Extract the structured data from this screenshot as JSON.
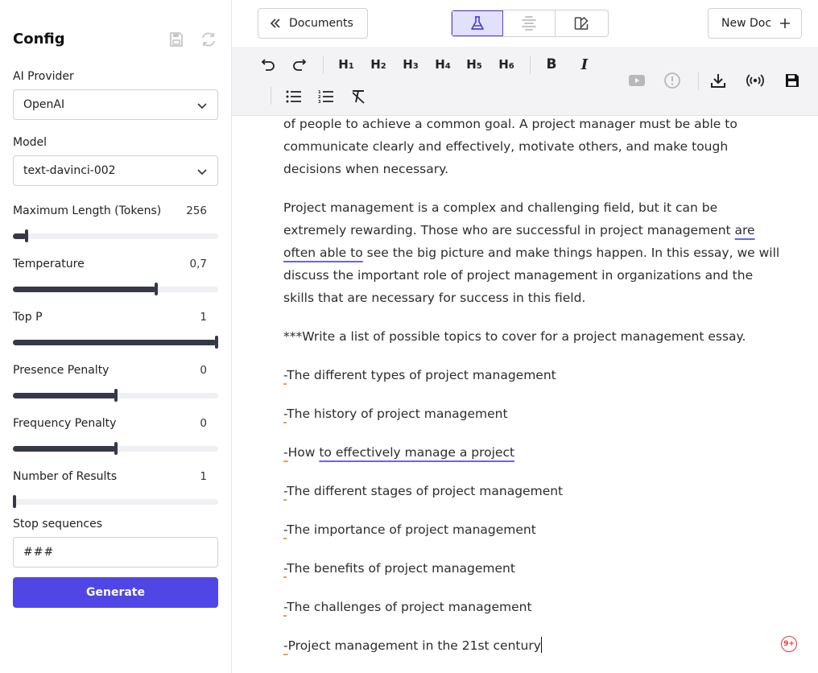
{
  "sidebar": {
    "title": "Config",
    "ai_provider": {
      "label": "AI Provider",
      "value": "OpenAI"
    },
    "model": {
      "label": "Model",
      "value": "text-davinci-002"
    },
    "sliders": [
      {
        "label": "Maximum Length (Tokens)",
        "value": "256",
        "fraction": 0.06
      },
      {
        "label": "Temperature",
        "value": "0,7",
        "fraction": 0.7
      },
      {
        "label": "Top P",
        "value": "1",
        "fraction": 1.0
      },
      {
        "label": "Presence Penalty",
        "value": "0",
        "fraction": 0.5
      },
      {
        "label": "Frequency Penalty",
        "value": "0",
        "fraction": 0.5
      },
      {
        "label": "Number of Results",
        "value": "1",
        "fraction": 0.0
      }
    ],
    "stop_sequences": {
      "label": "Stop sequences",
      "value": "###"
    },
    "generate_label": "Generate"
  },
  "topbar": {
    "documents_label": "Documents",
    "new_doc_label": "New Doc"
  },
  "toolbar": {
    "headings": [
      "H1",
      "H2",
      "H3",
      "H4",
      "H5",
      "H6"
    ],
    "bold": "B",
    "italic": "I"
  },
  "editor": {
    "para1": "of people to achieve a common goal. A project manager must be able to communicate clearly and effectively, motivate others, and make tough decisions when necessary.",
    "para2": {
      "before": "Project management is a complex and challenging field, but it can be extremely rewarding. Those who are successful in project management ",
      "highlight": "are often able to",
      "after": " see the big picture and make things happen. In this essay, we will discuss the important role of project management in organizations and the skills that are necessary for success in this field."
    },
    "prompt": "***Write a list of possible topics to cover for a project management essay.",
    "items": [
      {
        "dash": "-",
        "text": "The different types of project management"
      },
      {
        "dash": "-",
        "text": "The history of project management"
      },
      {
        "dash": "-",
        "text": "How ",
        "highlight": "to effectively manage a project"
      },
      {
        "dash": "-",
        "text": "The different stages of project management"
      },
      {
        "dash": "-",
        "text": "The importance of project management"
      },
      {
        "dash": "-",
        "text": "The benefits of project management"
      },
      {
        "dash": "-",
        "text": "The challenges of project management"
      },
      {
        "dash": "-",
        "text": "Project management in the 21st century"
      }
    ],
    "badge": "9+"
  },
  "colors": {
    "accent": "#5046e5",
    "slider_fill": "#343a48",
    "underline_blue": "#6b63e8",
    "underline_orange": "#f0a040",
    "badge_red": "#e03a3a"
  }
}
